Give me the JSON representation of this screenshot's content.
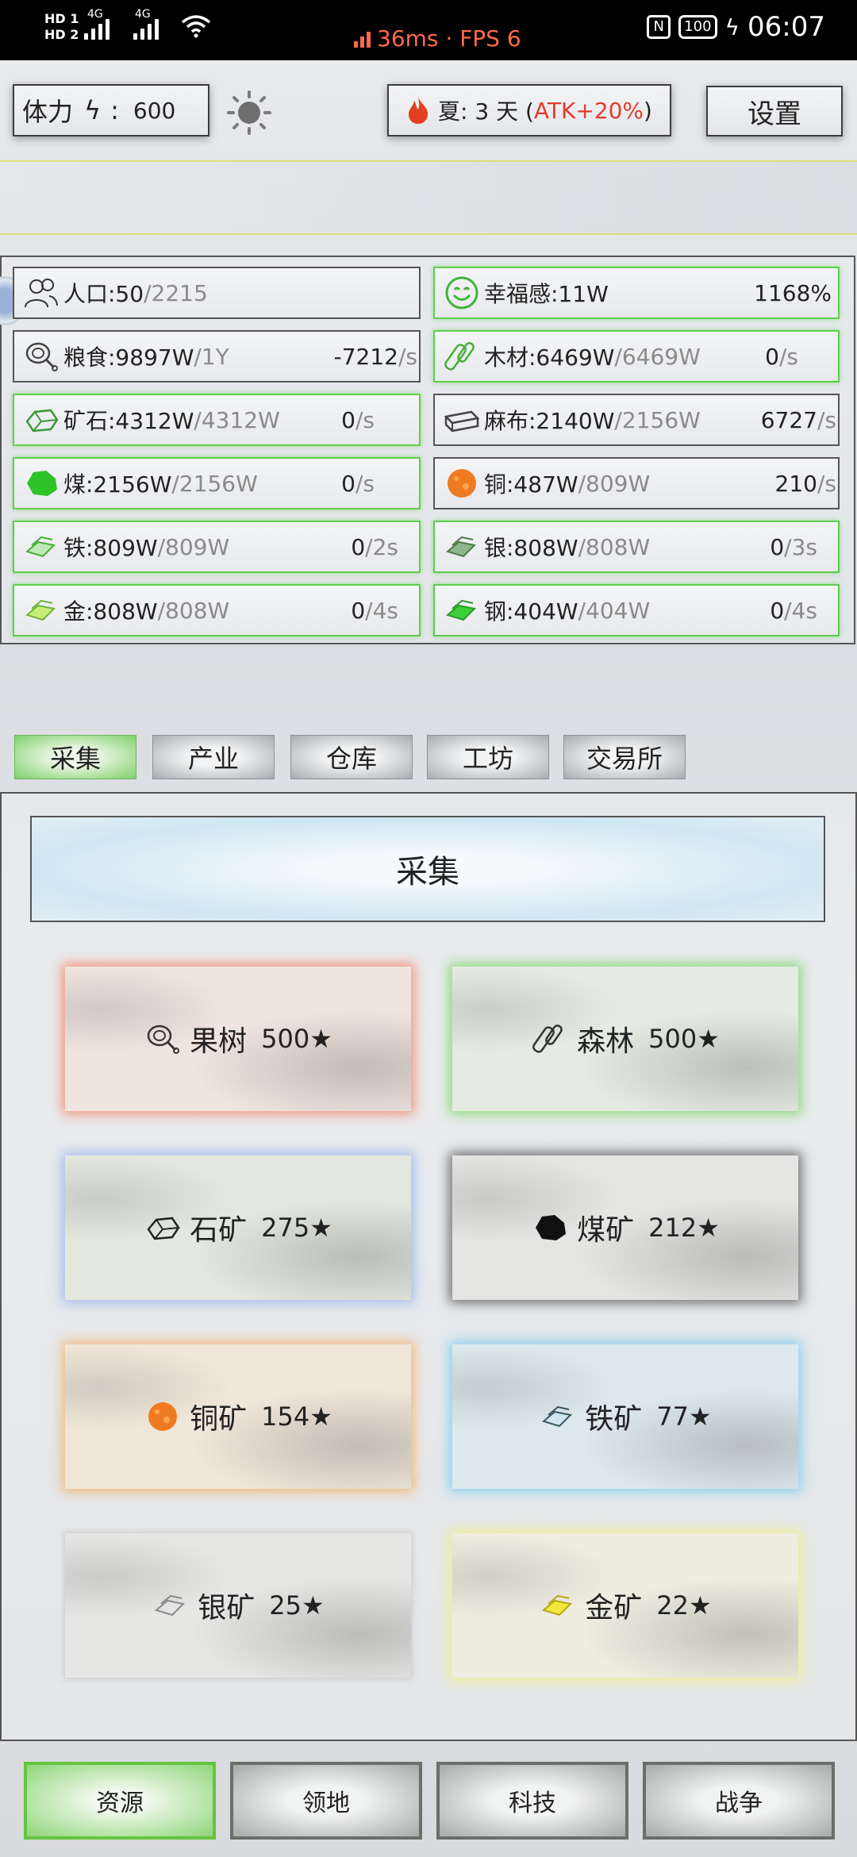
{
  "status_bar": {
    "sim1": "HD 1",
    "sim2": "HD 2",
    "net1": "4G",
    "net2": "4G",
    "latency": "36ms · FPS 6",
    "battery": "100",
    "time": "06:07"
  },
  "top": {
    "stamina_label": "体力",
    "stamina_sep": ":",
    "stamina_value": "600",
    "season_label": "夏: 3 天 (",
    "season_bonus": "ATK+20%",
    "season_close": ")",
    "settings_label": "设置"
  },
  "resources": [
    {
      "name": "人口:50",
      "max": "/2215",
      "rate": "",
      "unit": "",
      "icon": "people-icon"
    },
    {
      "name": "幸福感:11W",
      "max": "",
      "rate": "1168%",
      "unit": "",
      "icon": "smile-icon"
    },
    {
      "name": "粮食:9897W",
      "max": "/1Y",
      "rate": "-7212",
      "unit": "/s",
      "icon": "meat-icon"
    },
    {
      "name": "木材:6469W",
      "max": "/6469W",
      "rate": "0",
      "unit": "/s",
      "icon": "wood-icon"
    },
    {
      "name": "矿石:4312W",
      "max": "/4312W",
      "rate": "0",
      "unit": "/s",
      "icon": "stone-icon"
    },
    {
      "name": "麻布:2140W",
      "max": "/2156W",
      "rate": "6727",
      "unit": "/s",
      "icon": "cloth-icon"
    },
    {
      "name": "煤:2156W",
      "max": "/2156W",
      "rate": "0",
      "unit": "/s",
      "icon": "coal-icon"
    },
    {
      "name": "铜:487W",
      "max": "/809W",
      "rate": "210",
      "unit": "/s",
      "icon": "copper-icon"
    },
    {
      "name": "铁:809W",
      "max": "/809W",
      "rate": "0",
      "unit": "/2s",
      "icon": "iron-icon"
    },
    {
      "name": "银:808W",
      "max": "/808W",
      "rate": "0",
      "unit": "/3s",
      "icon": "silver-icon"
    },
    {
      "name": "金:808W",
      "max": "/808W",
      "rate": "0",
      "unit": "/4s",
      "icon": "gold-icon"
    },
    {
      "name": "钢:404W",
      "max": "/404W",
      "rate": "0",
      "unit": "/4s",
      "icon": "steel-icon"
    }
  ],
  "tabs": [
    "采集",
    "产业",
    "仓库",
    "工坊",
    "交易所"
  ],
  "section_title": "采集",
  "cards": [
    {
      "label": "果树",
      "value": "500★",
      "icon": "meat-icon"
    },
    {
      "label": "森林",
      "value": "500★",
      "icon": "wood-icon"
    },
    {
      "label": "石矿",
      "value": "275★",
      "icon": "stone-icon"
    },
    {
      "label": "煤矿",
      "value": "212★",
      "icon": "coal-icon"
    },
    {
      "label": "铜矿",
      "value": "154★",
      "icon": "copper-icon"
    },
    {
      "label": "铁矿",
      "value": "77★",
      "icon": "iron-icon"
    },
    {
      "label": "银矿",
      "value": "25★",
      "icon": "silver-icon"
    },
    {
      "label": "金矿",
      "value": "22★",
      "icon": "gold-icon"
    }
  ],
  "bottom_nav": [
    "资源",
    "领地",
    "科技",
    "战争"
  ],
  "colors": {
    "accent_green": "#5fce4c",
    "rate_red": "#e23b2e",
    "status_orange": "#ff6a4a"
  }
}
